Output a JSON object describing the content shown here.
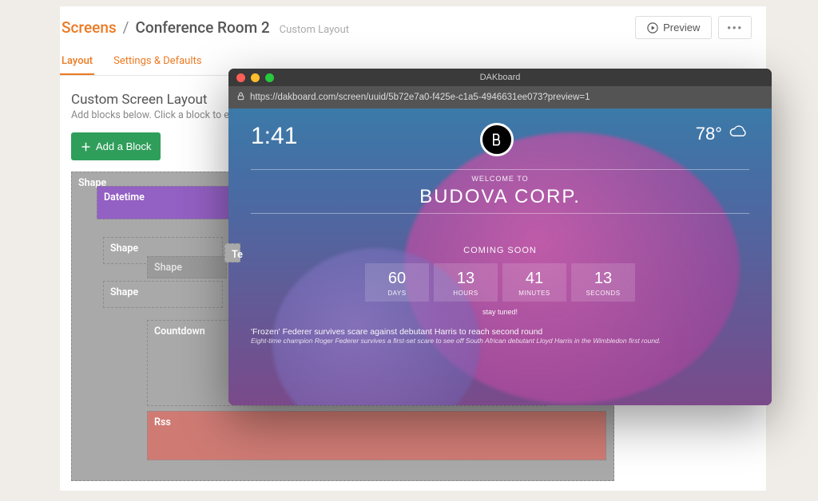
{
  "breadcrumb": {
    "root": "Screens",
    "slash": "/",
    "screen": "Conference Room 2",
    "layout_type": "Custom Layout"
  },
  "topbar": {
    "preview_label": "Preview",
    "more_label": "•••"
  },
  "tabs": {
    "layout": "Layout",
    "settings": "Settings & Defaults"
  },
  "section": {
    "title": "Custom Screen Layout",
    "subtitle": "Add blocks below. Click a block to edit the",
    "add_block": "Add a Block"
  },
  "blocks": {
    "shape_outer": "Shape",
    "datetime": "Datetime",
    "shape_a": "Shape",
    "shape_dim": "Shape",
    "shape_b": "Shape",
    "partial_te": "Te",
    "countdown": "Countdown",
    "rss": "Rss"
  },
  "preview_window": {
    "title": "DAKboard",
    "url": "https://dakboard.com/screen/uuid/5b72e7a0-f425e-c1a5-4946631ee073?preview=1",
    "clock": "1:41",
    "weather_temp": "78°",
    "welcome_small": "WELCOME TO",
    "company": "BUDOVA CORP.",
    "coming_soon": "COMING SOON",
    "countdown": {
      "days": {
        "num": "60",
        "label": "DAYS"
      },
      "hours": {
        "num": "13",
        "label": "HOURS"
      },
      "minutes": {
        "num": "41",
        "label": "MINUTES"
      },
      "seconds": {
        "num": "13",
        "label": "SECONDS"
      }
    },
    "stay_tuned": "stay tuned!",
    "news": {
      "headline": "'Frozen' Federer survives scare against debutant Harris to reach second round",
      "sub": "Eight-time champion Roger Federer survives a first-set scare to see off South African debutant Lloyd Harris in the Wimbledon first round."
    }
  }
}
